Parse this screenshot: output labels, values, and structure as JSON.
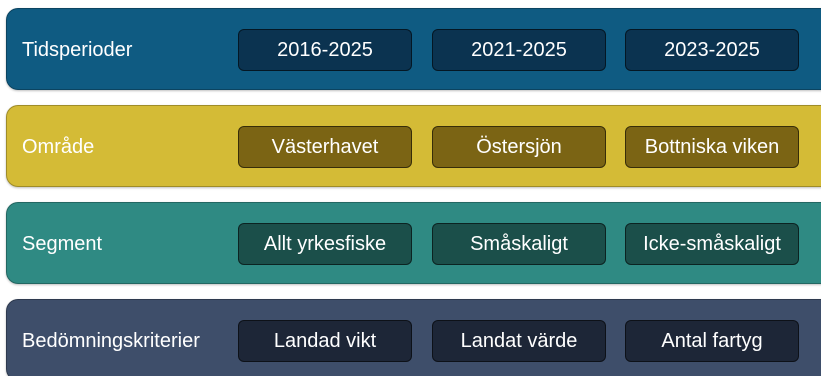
{
  "rows": [
    {
      "label": "Tidsperioder",
      "color": "#0f5b82",
      "chip_color": "#0b3350",
      "chips": [
        "2016-2025",
        "2021-2025",
        "2023-2025"
      ]
    },
    {
      "label": "Område",
      "color": "#d4bb36",
      "chip_color": "#7b6414",
      "chips": [
        "Västerhavet",
        "Östersjön",
        "Bottniska viken"
      ]
    },
    {
      "label": "Segment",
      "color": "#2f8a83",
      "chip_color": "#1b4f4a",
      "chips": [
        "Allt yrkesfiske",
        "Småskaligt",
        "Icke-småskaligt"
      ]
    },
    {
      "label": "Bedömningskriterier",
      "color": "#3e4e6a",
      "chip_color": "#1d2637",
      "chips": [
        "Landad vikt",
        "Landat värde",
        "Antal fartyg"
      ]
    }
  ]
}
